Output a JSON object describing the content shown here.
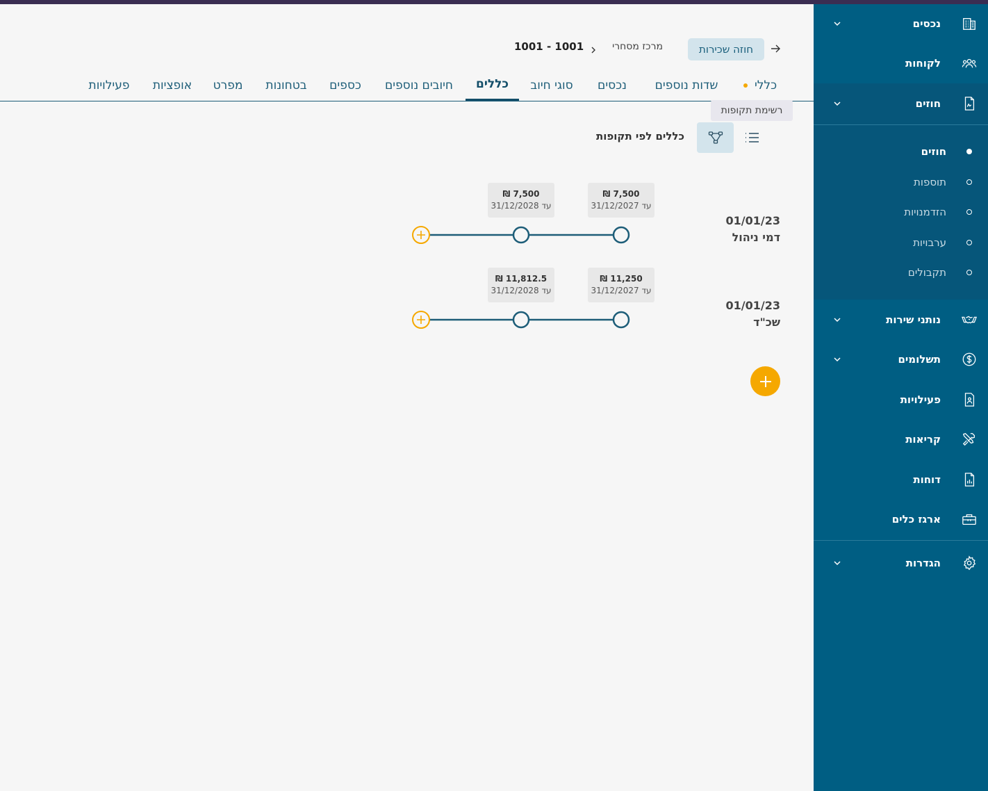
{
  "sidebar": {
    "items": [
      {
        "label": "נכסים",
        "icon": "building-icon"
      },
      {
        "label": "לקוחות",
        "icon": "users-icon"
      },
      {
        "label": "חוזים",
        "icon": "contract-icon"
      },
      {
        "label": "נותני שירות",
        "icon": "handshake-icon"
      },
      {
        "label": "תשלומים",
        "icon": "dollar-circle-icon"
      },
      {
        "label": "פעילויות",
        "icon": "activity-doc-icon"
      },
      {
        "label": "קריאות",
        "icon": "tools-icon"
      },
      {
        "label": "דוחות",
        "icon": "report-icon"
      },
      {
        "label": "ארגז כלים",
        "icon": "toolbox-icon"
      },
      {
        "label": "הגדרות",
        "icon": "gear-icon"
      }
    ],
    "contracts_sub": [
      {
        "label": "חוזים",
        "active": true
      },
      {
        "label": "תוספות",
        "active": false
      },
      {
        "label": "הזדמנויות",
        "active": false
      },
      {
        "label": "ערבויות",
        "active": false
      },
      {
        "label": "תקבולים",
        "active": false
      }
    ]
  },
  "header": {
    "contract_type": "חוזה שכירות",
    "property": "מרכז מסחרי",
    "contract_id": "1001 - 1001"
  },
  "tabs": [
    {
      "label": "כללי"
    },
    {
      "label": "שדות נוספים"
    },
    {
      "label": "נכסים"
    },
    {
      "label": "סוגי חיוב"
    },
    {
      "label": "כללים"
    },
    {
      "label": "חיובים נוספים"
    },
    {
      "label": "כספים"
    },
    {
      "label": "בטחונות"
    },
    {
      "label": "מפרט"
    },
    {
      "label": "אופציות"
    },
    {
      "label": "פעילויות"
    }
  ],
  "tooltip": "רשימת תקופות",
  "view_title": "כללים לפי תקופות",
  "rules": [
    {
      "date": "01/01/23",
      "name": "דמי ניהול",
      "periods": [
        {
          "amount": "7,500 ₪",
          "until": "עד 31/12/2027"
        },
        {
          "amount": "7,500 ₪",
          "until": "עד 31/12/2028"
        }
      ]
    },
    {
      "date": "01/01/23",
      "name": "שכ\"ד",
      "periods": [
        {
          "amount": "11,250 ₪",
          "until": "עד 31/12/2027"
        },
        {
          "amount": "11,812.5 ₪",
          "until": "עד 31/12/2028"
        }
      ]
    }
  ],
  "colors": {
    "sidebar_bg": "#005e83",
    "accent": "#f5a800",
    "primary_text": "#1d5d78",
    "topbar": "#3a2d52"
  }
}
